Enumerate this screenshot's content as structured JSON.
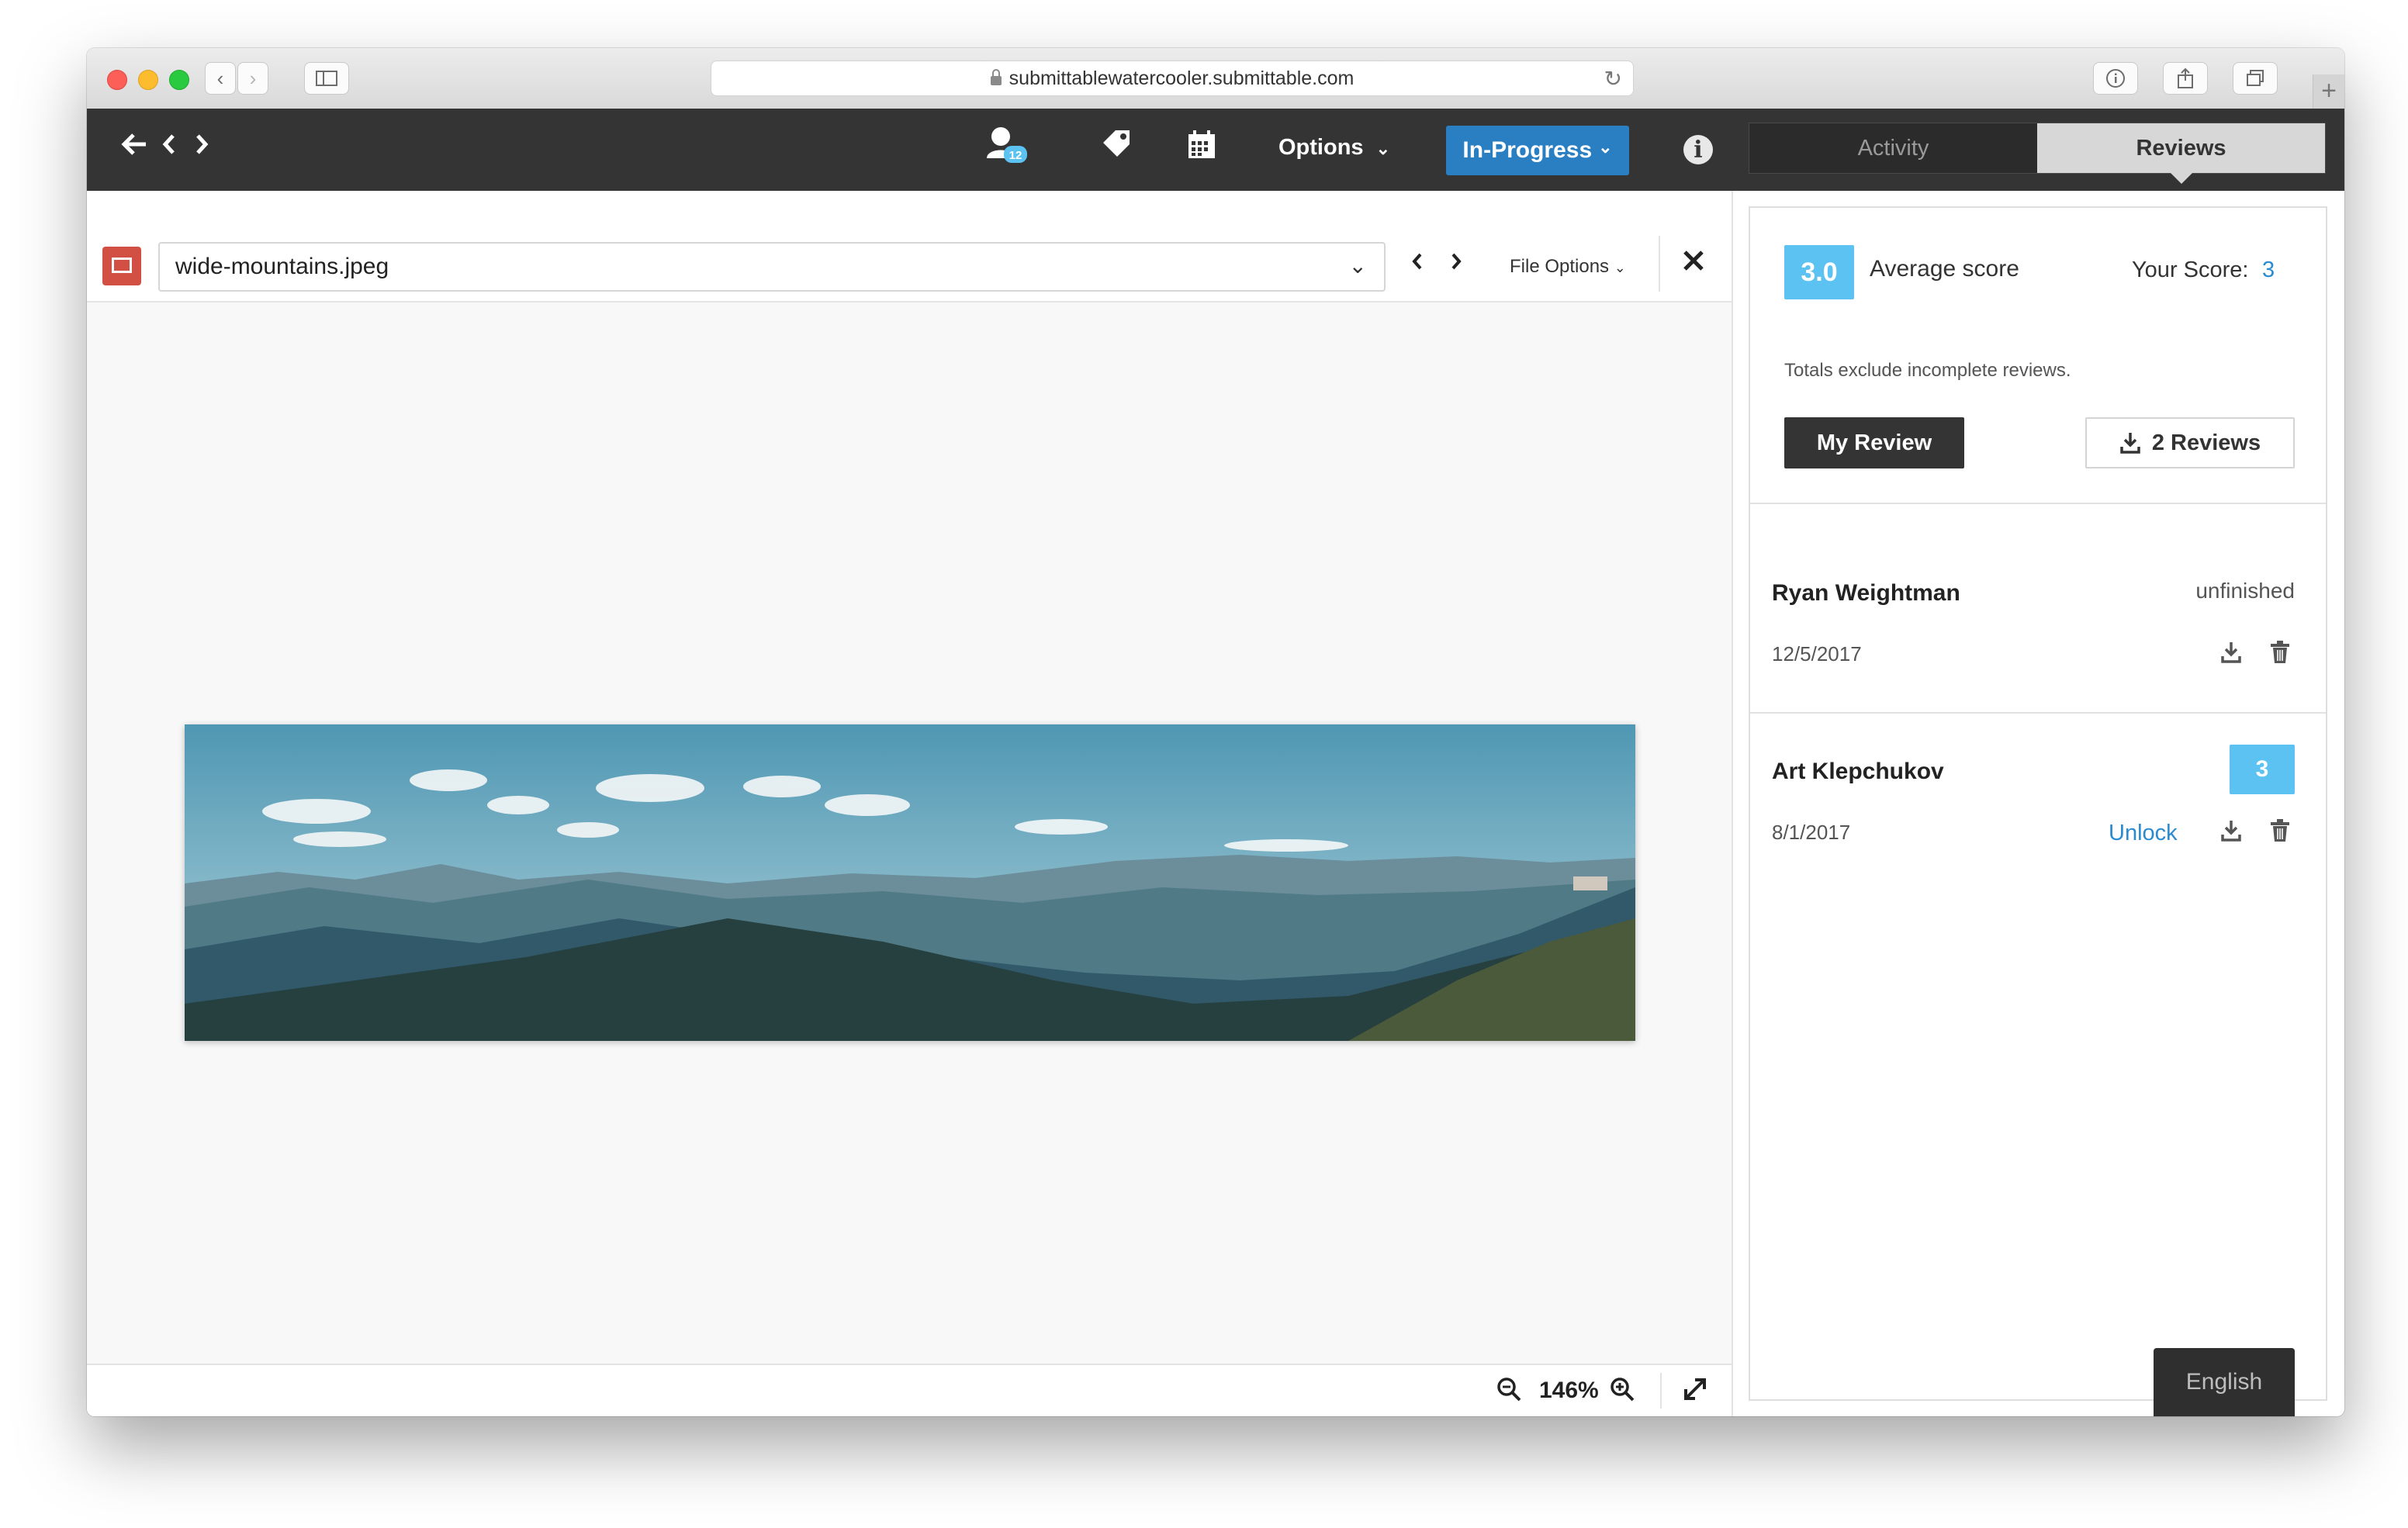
{
  "browser": {
    "url": "submittablewatercooler.submittable.com"
  },
  "navbar": {
    "badge_count": "12",
    "options_label": "Options",
    "status_label": "In-Progress",
    "tabs": [
      {
        "label": "Activity",
        "active": false
      },
      {
        "label": "Reviews",
        "active": true
      }
    ]
  },
  "viewer": {
    "file_name": "wide-mountains.jpeg",
    "file_options_label": "File Options",
    "zoom_level": "146%"
  },
  "reviews_panel": {
    "average_score": "3.0",
    "average_label": "Average score",
    "your_score_label": "Your Score:",
    "your_score_value": "3",
    "totals_note": "Totals exclude incomplete reviews.",
    "my_review_label": "My Review",
    "reviews_button_label": "2 Reviews",
    "reviews": [
      {
        "name": "Ryan Weightman",
        "date": "12/5/2017",
        "status": "unfinished"
      },
      {
        "name": "Art Klepchukov",
        "date": "8/1/2017",
        "score": "3",
        "action": "Unlock"
      }
    ]
  },
  "language_label": "English",
  "colors": {
    "nav_bg": "#343434",
    "accent_blue": "#2a7ec2",
    "score_blue": "#5cc2f2",
    "link_blue": "#2a8bd0",
    "file_icon_red": "#d24f43"
  }
}
